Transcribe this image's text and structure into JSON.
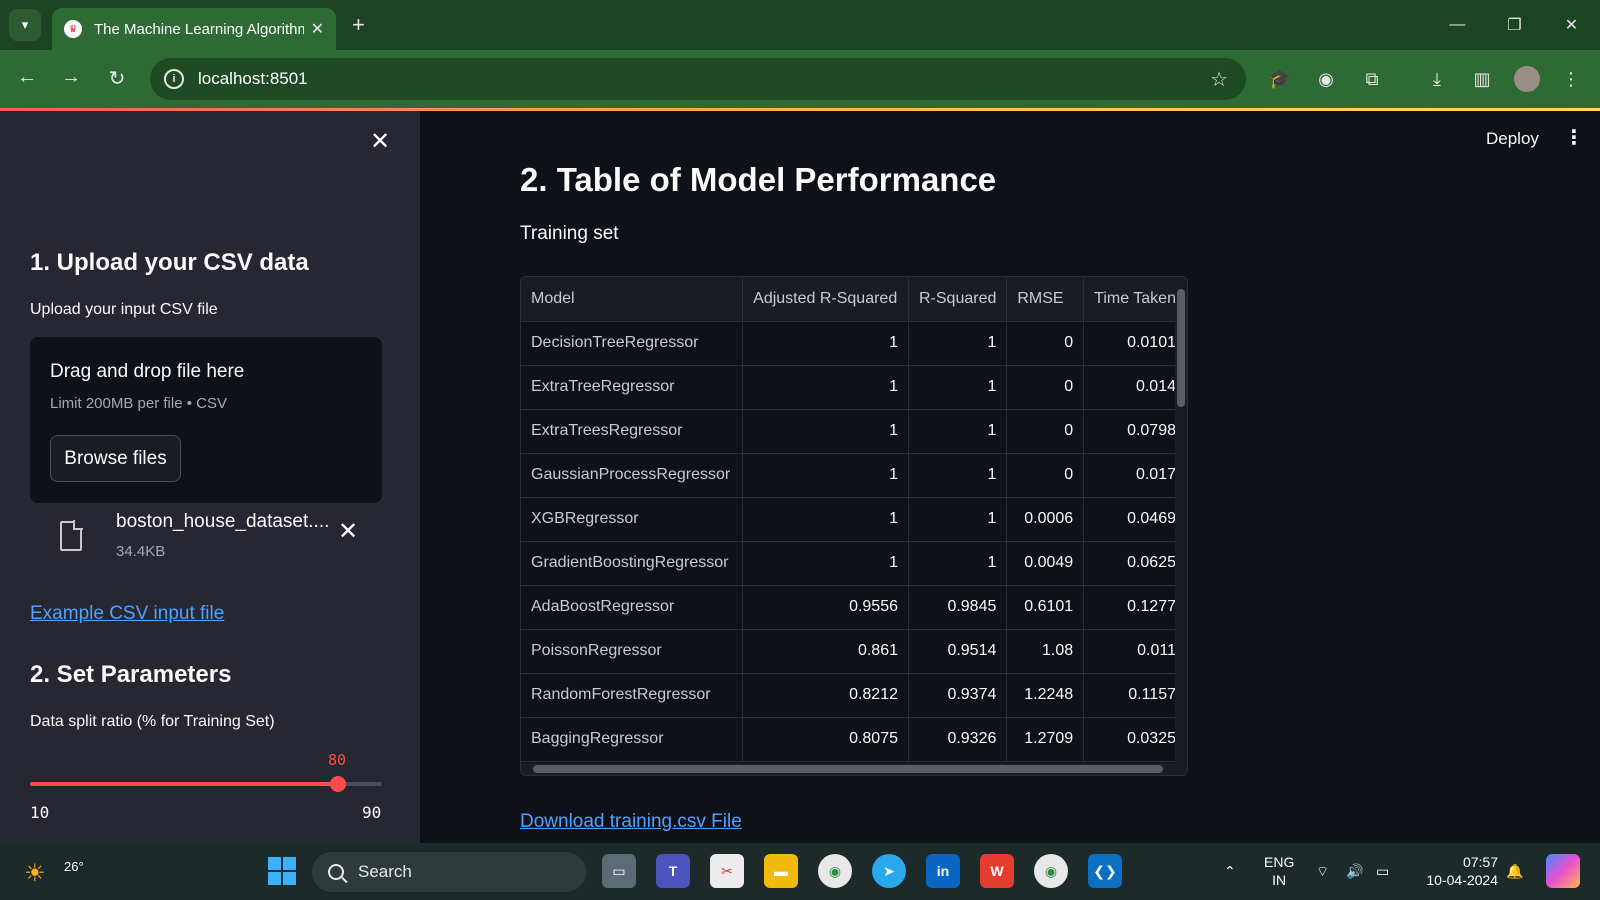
{
  "browser": {
    "tab_title": "The Machine Learning Algorithm Comparison App",
    "tab_close": "✕",
    "new_tab": "+",
    "url": "localhost:8501",
    "minimize": "—",
    "restore": "❐",
    "close": "✕"
  },
  "sidebar": {
    "close_glyph": "✕",
    "upload_heading": "1. Upload your CSV data",
    "upload_label": "Upload your input CSV file",
    "dropzone_title": "Drag and drop file here",
    "dropzone_sub": "Limit 200MB per file • CSV",
    "browse_button": "Browse files",
    "file_name": "boston_house_dataset....",
    "file_size": "34.4KB",
    "remove_glyph": "✕",
    "example_link": "Example CSV input file",
    "params_heading": "2. Set Parameters",
    "split_label": "Data split ratio (% for Training Set)",
    "slider": {
      "value": 80,
      "min": 10,
      "max": 90,
      "value_label": "80",
      "min_label": "10",
      "max_label": "90"
    }
  },
  "main": {
    "deploy": "Deploy",
    "menu_glyph": "⋮",
    "title": "2. Table of Model Performance",
    "subtitle": "Training set",
    "download_link": "Download training.csv File",
    "table": {
      "columns": [
        "Model",
        "Adjusted R-Squared",
        "R-Squared",
        "RMSE",
        "Time Taken"
      ],
      "rows": [
        [
          "DecisionTreeRegressor",
          "1",
          "1",
          "0",
          "0.0101"
        ],
        [
          "ExtraTreeRegressor",
          "1",
          "1",
          "0",
          "0.014"
        ],
        [
          "ExtraTreesRegressor",
          "1",
          "1",
          "0",
          "0.0798"
        ],
        [
          "GaussianProcessRegressor",
          "1",
          "1",
          "0",
          "0.017"
        ],
        [
          "XGBRegressor",
          "1",
          "1",
          "0.0006",
          "0.0469"
        ],
        [
          "GradientBoostingRegressor",
          "1",
          "1",
          "0.0049",
          "0.0625"
        ],
        [
          "AdaBoostRegressor",
          "0.9556",
          "0.9845",
          "0.6101",
          "0.1277"
        ],
        [
          "PoissonRegressor",
          "0.861",
          "0.9514",
          "1.08",
          "0.011"
        ],
        [
          "RandomForestRegressor",
          "0.8212",
          "0.9374",
          "1.2248",
          "0.1157"
        ],
        [
          "BaggingRegressor",
          "0.8075",
          "0.9326",
          "1.2709",
          "0.0325"
        ]
      ]
    }
  },
  "taskbar": {
    "temperature": "26°",
    "search_text": "Search",
    "language": "ENG",
    "region": "IN",
    "time": "07:57",
    "date": "10-04-2024"
  },
  "colors": {
    "accent": "#ff4b4b",
    "link": "#4fa2ff",
    "browser_frame": "#2e6a34",
    "app_bg": "#0e1117",
    "sidebar_bg": "#262730"
  }
}
